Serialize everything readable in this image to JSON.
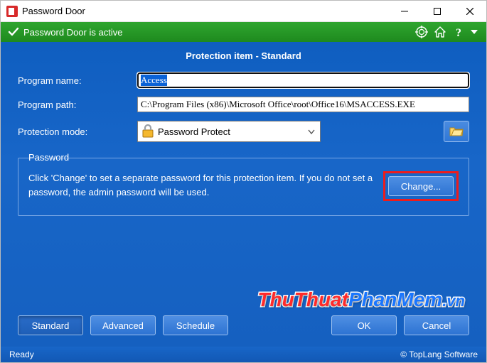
{
  "title": "Password Door",
  "status": "Password Door is active",
  "subtitle": "Protection item - Standard",
  "labels": {
    "program_name": "Program name:",
    "program_path": "Program path:",
    "protection_mode": "Protection mode:"
  },
  "values": {
    "program_name": "Access",
    "program_path": "C:\\Program Files (x86)\\Microsoft Office\\root\\Office16\\MSACCESS.EXE",
    "protection_mode": "Password Protect"
  },
  "fieldset": {
    "legend": "Password",
    "info": "Click 'Change' to set a separate password for this protection item. If you do not set a password, the admin password will be used.",
    "change": "Change..."
  },
  "buttons": {
    "standard": "Standard",
    "advanced": "Advanced",
    "schedule": "Schedule",
    "ok": "OK",
    "cancel": "Cancel"
  },
  "footer": {
    "left": "Ready",
    "right": "© TopLang Software"
  },
  "watermark": {
    "a": "ThuThuat",
    "b": "PhanMem",
    "c": ".vn"
  }
}
